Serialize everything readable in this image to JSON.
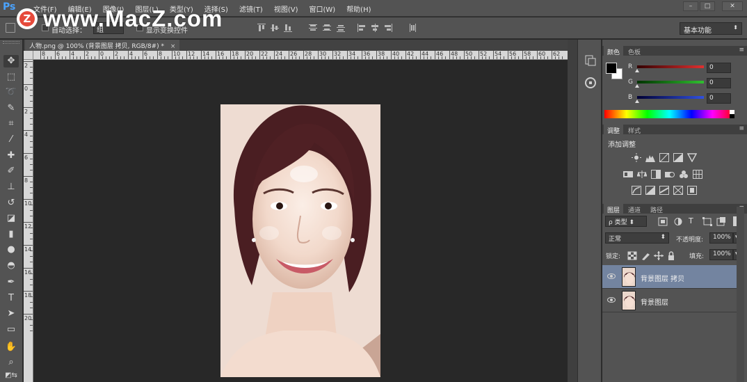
{
  "app": {
    "logo": "Ps",
    "menu": [
      "文件(F)",
      "编辑(E)",
      "图像(I)",
      "图层(L)",
      "类型(Y)",
      "选择(S)",
      "滤镜(T)",
      "视图(V)",
      "窗口(W)",
      "帮助(H)"
    ],
    "window_controls": [
      "minimize-icon",
      "restore-icon",
      "close-icon"
    ]
  },
  "watermark": {
    "badge": "Z",
    "text": "www.MacZ.com"
  },
  "options": {
    "auto_select_label": "自动选择：",
    "auto_select_target": "组",
    "show_transform_label": "显示变换控件",
    "workspace": "基本功能"
  },
  "document": {
    "tab_title": "人物.png @ 100% (背景图层 拷贝, RGB/8#) *",
    "close": "×"
  },
  "rulers": {
    "top": [
      "8",
      "6",
      "4",
      "2",
      "0",
      "2",
      "4",
      "6",
      "8",
      "10",
      "12",
      "14",
      "16",
      "18",
      "20",
      "22",
      "24",
      "26",
      "28",
      "30",
      "32",
      "34",
      "36",
      "38",
      "40",
      "42",
      "44",
      "46",
      "48",
      "50",
      "52",
      "54",
      "56",
      "58",
      "60",
      "62",
      "64",
      "66"
    ],
    "left": [
      "2",
      "0",
      "2",
      "4",
      "6",
      "8",
      "10",
      "12",
      "14",
      "16",
      "18",
      "20"
    ]
  },
  "panels": {
    "color": {
      "tabs": [
        "颜色",
        "色板"
      ],
      "channels": [
        {
          "label": "R",
          "value": "0",
          "color": "#e03030"
        },
        {
          "label": "G",
          "value": "0",
          "color": "#30c030"
        },
        {
          "label": "B",
          "value": "0",
          "color": "#3050e0"
        }
      ]
    },
    "adjustments": {
      "tabs": [
        "调整",
        "样式"
      ],
      "title": "添加调整"
    },
    "layers": {
      "tabs": [
        "图层",
        "通道",
        "路径"
      ],
      "filter_kind": "ρ 类型",
      "blend_mode": "正常",
      "opacity_label": "不透明度:",
      "opacity_value": "100%",
      "lock_label": "锁定:",
      "fill_label": "填充:",
      "fill_value": "100%",
      "items": [
        {
          "name": "背景图层 拷贝",
          "selected": true
        },
        {
          "name": "背景图层",
          "selected": false
        }
      ]
    }
  }
}
